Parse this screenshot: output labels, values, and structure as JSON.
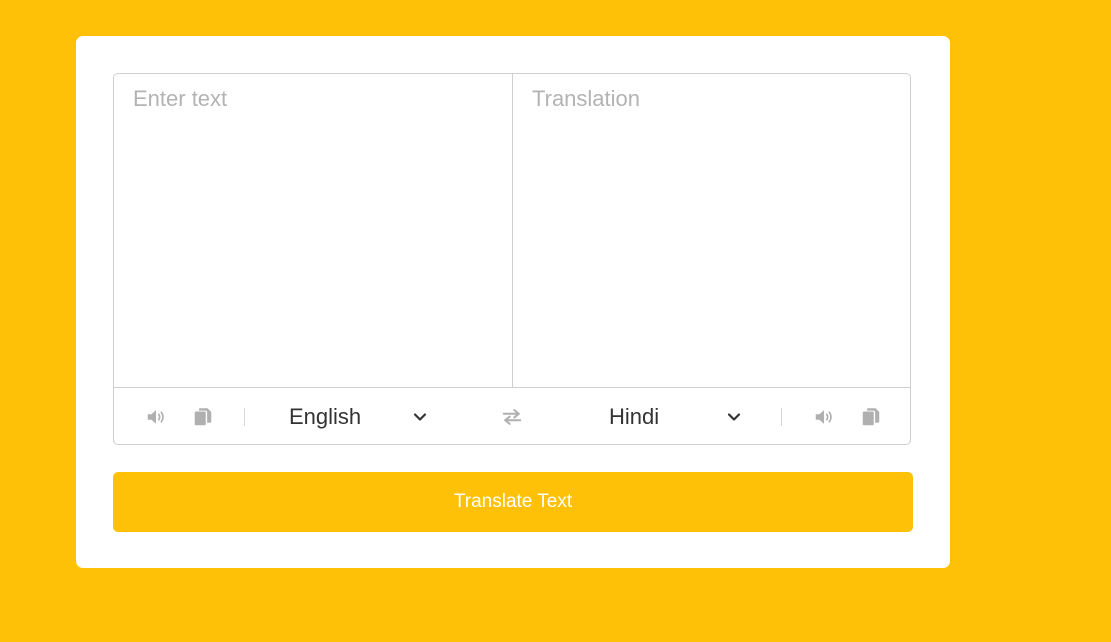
{
  "input": {
    "placeholder": "Enter text",
    "value": ""
  },
  "output": {
    "placeholder": "Translation",
    "value": ""
  },
  "controls": {
    "from_language": "English",
    "to_language": "Hindi",
    "icons": {
      "from_speak": "volume-icon",
      "from_copy": "copy-icon",
      "exchange": "exchange-icon",
      "to_speak": "volume-icon",
      "to_copy": "copy-icon",
      "dropdown": "chevron-down-icon"
    },
    "icon_color": "#b0b0b0"
  },
  "button": {
    "label": "Translate Text"
  },
  "colors": {
    "background": "#FFC107",
    "card": "#ffffff",
    "border": "#cfcfcf",
    "placeholder": "#b3b3b3",
    "button": "#FFC107",
    "button_text": "#ffffff"
  }
}
